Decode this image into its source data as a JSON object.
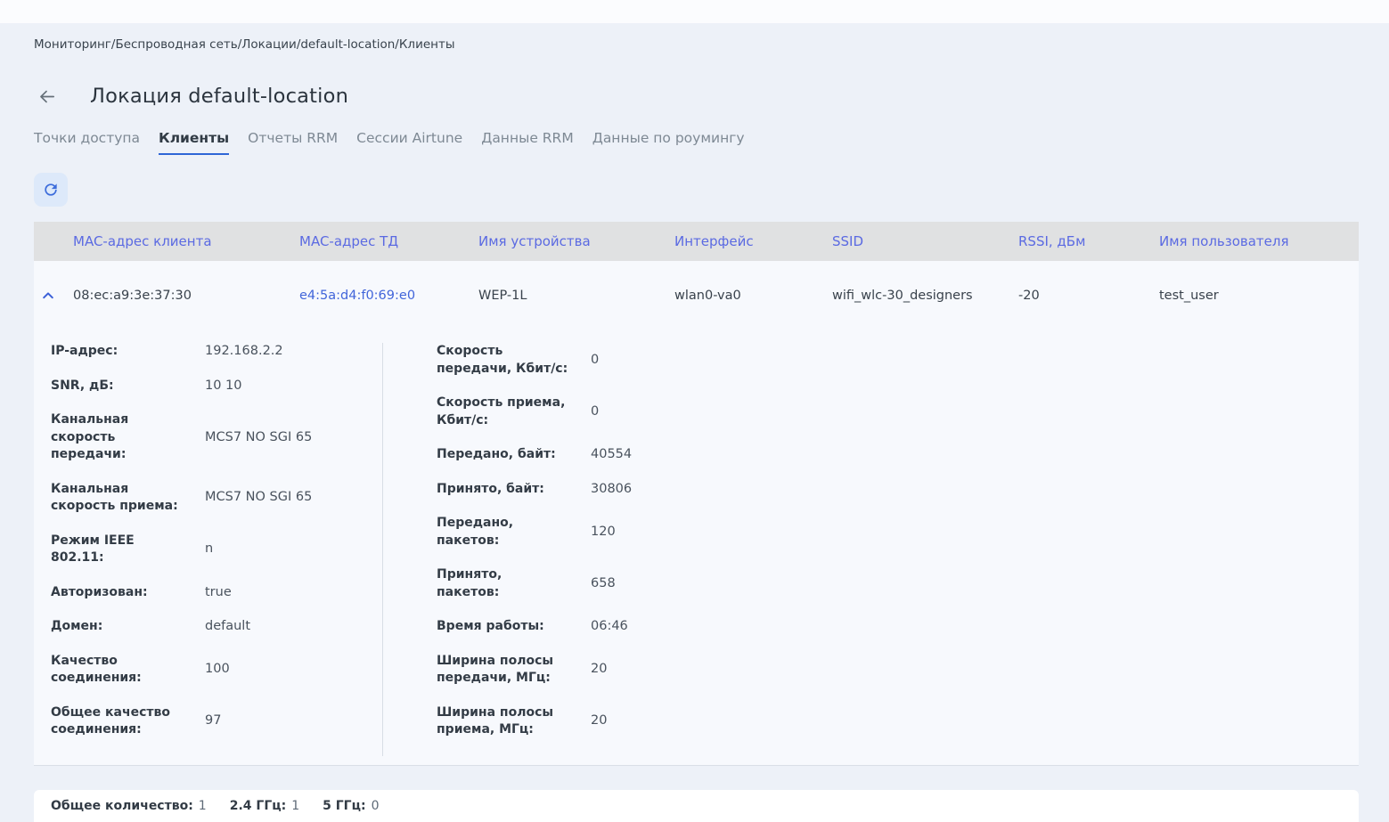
{
  "colors": {
    "page_bg": "#edf1f8",
    "accent_blue": "#3c6cdb",
    "link_blue": "#4165da",
    "table_header_text": "#5b6ae2",
    "table_header_bg": "#e0e1e2",
    "active_tab_underline": "#2e66d6",
    "refresh_button_bg": "#dde9fa",
    "card_bg": "#f7f9fd",
    "footer_bg": "#ffffff"
  },
  "breadcrumb": {
    "path": "Мониторинг/Беспроводная сеть/Локации/default-location/Клиенты"
  },
  "header": {
    "title": "Локация default-location",
    "back_icon": "arrow-left"
  },
  "tabs": [
    {
      "label": "Точки доступа",
      "active": false
    },
    {
      "label": "Клиенты",
      "active": true
    },
    {
      "label": "Отчеты RRM",
      "active": false
    },
    {
      "label": "Сессии Airtune",
      "active": false
    },
    {
      "label": "Данные RRM",
      "active": false
    },
    {
      "label": "Данные по роумингу",
      "active": false
    }
  ],
  "toolbar": {
    "refresh_icon": "refresh"
  },
  "table": {
    "columns": [
      "MAC-адрес клиента",
      "MAC-адрес ТД",
      "Имя устройства",
      "Интерфейс",
      "SSID",
      "RSSI, дБм",
      "Имя пользователя"
    ],
    "row": {
      "expanded": true,
      "collapse_icon": "chevron-up",
      "client_mac": "08:ec:a9:3e:37:30",
      "ap_mac": "e4:5a:d4:f0:69:e0",
      "device_name": "WEP-1L",
      "interface": "wlan0-va0",
      "ssid": "wifi_wlc-30_designers",
      "rssi": "-20",
      "username": "test_user"
    }
  },
  "details": {
    "left": [
      {
        "label": "IP-адрес:",
        "value": "192.168.2.2"
      },
      {
        "label": "SNR, дБ:",
        "value": "10 10"
      },
      {
        "label": "Канальная скорость передачи:",
        "value": "MCS7 NO SGI 65"
      },
      {
        "label": "Канальная скорость приема:",
        "value": "MCS7 NO SGI 65"
      },
      {
        "label": "Режим IEEE 802.11:",
        "value": "n"
      },
      {
        "label": "Авторизован:",
        "value": "true"
      },
      {
        "label": "Домен:",
        "value": "default"
      },
      {
        "label": "Качество соединения:",
        "value": "100"
      },
      {
        "label": "Общее качество соединения:",
        "value": "97"
      }
    ],
    "right": [
      {
        "label": "Скорость передачи, Кбит/с:",
        "value": "0"
      },
      {
        "label": "Скорость приема, Кбит/с:",
        "value": "0"
      },
      {
        "label": "Передано, байт:",
        "value": "40554"
      },
      {
        "label": "Принято, байт:",
        "value": "30806"
      },
      {
        "label": "Передано, пакетов:",
        "value": "120"
      },
      {
        "label": "Принято, пакетов:",
        "value": "658"
      },
      {
        "label": "Время работы:",
        "value": "06:46"
      },
      {
        "label": "Ширина полосы передачи, МГц:",
        "value": "20"
      },
      {
        "label": "Ширина полосы приема, МГц:",
        "value": "20"
      }
    ]
  },
  "footer": {
    "items": [
      {
        "label": "Общее количество:",
        "value": "1"
      },
      {
        "label": "2.4 ГГц:",
        "value": "1"
      },
      {
        "label": "5 ГГц:",
        "value": "0"
      }
    ]
  }
}
